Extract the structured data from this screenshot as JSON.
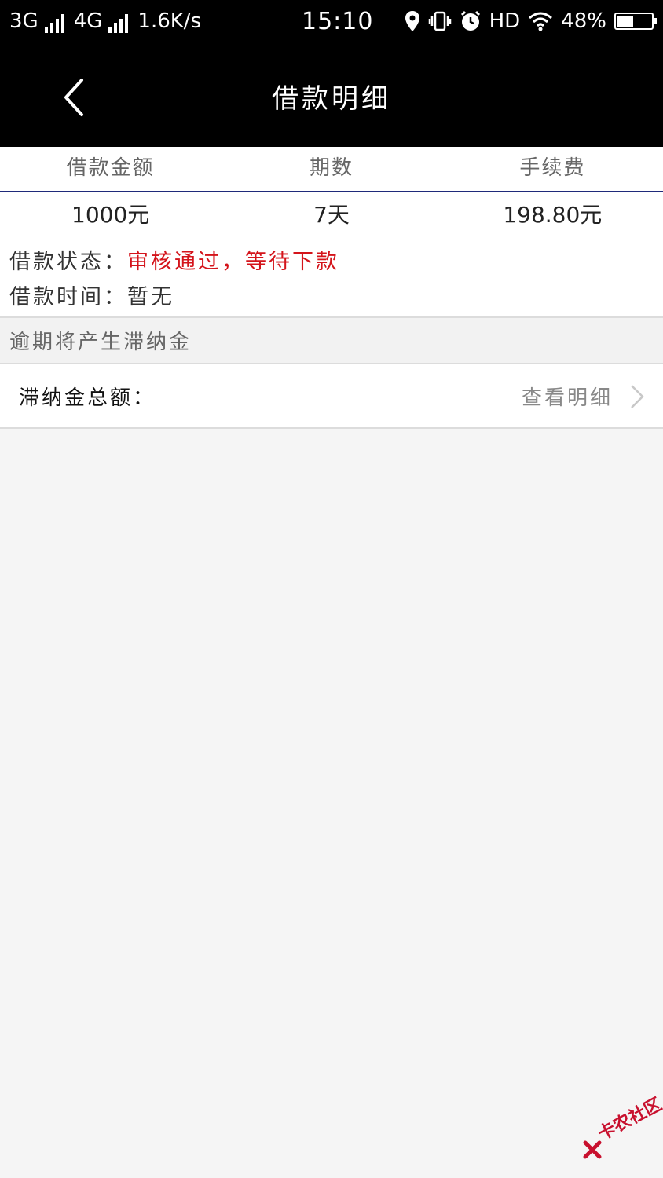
{
  "status_bar": {
    "network1": "3G",
    "network2": "4G",
    "speed": "1.6K/s",
    "time": "15:10",
    "hd": "HD",
    "battery": "48%",
    "battery_level": 0.48
  },
  "nav": {
    "title": "借款明细"
  },
  "summary": {
    "headers": [
      "借款金额",
      "期数",
      "手续费"
    ],
    "values": [
      "1000元",
      "7天",
      "198.80元"
    ]
  },
  "loan_status": {
    "label": "借款状态：",
    "value": "审核通过，等待下款"
  },
  "loan_time": {
    "label": "借款时间：",
    "value": "暂无"
  },
  "notice": "逾期将产生滞纳金",
  "late_fee": {
    "label": "滞纳金总额：",
    "link": "查看明细"
  },
  "watermark": "卡农社区",
  "colors": {
    "status_red": "#d4141b",
    "header_bar": "#000000",
    "divider_blue": "#1f2a7a"
  }
}
